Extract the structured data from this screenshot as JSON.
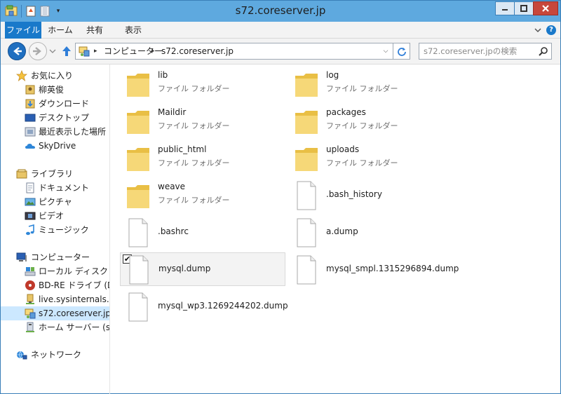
{
  "window": {
    "title": "s72.coreserver.jp"
  },
  "quick_access": {
    "dropdown_glyph": "▾"
  },
  "ribbon": {
    "tabs": [
      "ファイル",
      "ホーム",
      "共有",
      "表示"
    ],
    "help_glyph": "?"
  },
  "address": {
    "crumbs": [
      "コンピューター",
      "s72.coreserver.jp"
    ],
    "separator": "▸",
    "dropdown_glyph": "⌵"
  },
  "search": {
    "placeholder": "s72.coreserver.jpの検索"
  },
  "sidebar": {
    "favorites": {
      "label": "お気に入り",
      "items": [
        "柳英俊",
        "ダウンロード",
        "デスクトップ",
        "最近表示した場所",
        "SkyDrive"
      ]
    },
    "libraries": {
      "label": "ライブラリ",
      "items": [
        "ドキュメント",
        "ピクチャ",
        "ビデオ",
        "ミュージック"
      ]
    },
    "computer": {
      "label": "コンピューター",
      "items": [
        "ローカル ディスク (C:)",
        "BD-RE ドライブ (D:)",
        "live.sysinternals.com",
        "s72.coreserver.jp",
        "ホーム サーバー (serv"
      ]
    },
    "network": {
      "label": "ネットワーク"
    }
  },
  "files": [
    {
      "name": "lib",
      "type": "ファイル フォルダー",
      "kind": "folder"
    },
    {
      "name": "log",
      "type": "ファイル フォルダー",
      "kind": "folder"
    },
    {
      "name": "Maildir",
      "type": "ファイル フォルダー",
      "kind": "folder"
    },
    {
      "name": "packages",
      "type": "ファイル フォルダー",
      "kind": "folder"
    },
    {
      "name": "public_html",
      "type": "ファイル フォルダー",
      "kind": "folder"
    },
    {
      "name": "uploads",
      "type": "ファイル フォルダー",
      "kind": "folder"
    },
    {
      "name": "weave",
      "type": "ファイル フォルダー",
      "kind": "folder"
    },
    {
      "name": ".bash_history",
      "kind": "file"
    },
    {
      "name": ".bashrc",
      "kind": "file"
    },
    {
      "name": "a.dump",
      "kind": "file"
    },
    {
      "name": "mysql.dump",
      "kind": "file",
      "selected": true,
      "check_glyph": "✔"
    },
    {
      "name": "mysql_smpl.1315296894.dump",
      "kind": "file"
    },
    {
      "name": "mysql_wp3.1269244202.dump",
      "kind": "file"
    }
  ],
  "colors": {
    "title_bar": "#5ea9df",
    "file_tab": "#1979ca",
    "selection": "#cce8ff",
    "folder": "#f2cc5f"
  }
}
